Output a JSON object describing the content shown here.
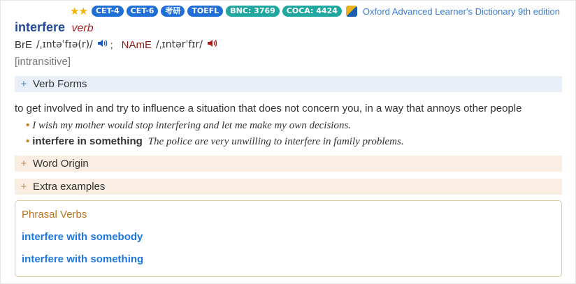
{
  "header": {
    "stars": "★★",
    "badges": [
      "CET-4",
      "CET-6",
      "考研",
      "TOEFL",
      "BNC: 3769",
      "COCA: 4424"
    ],
    "dictionary_name": "Oxford Advanced Learner's Dictionary 9th edition"
  },
  "entry": {
    "headword": "interfere",
    "pos": "verb",
    "pron_br_label": "BrE",
    "pron_br_ipa": "/ˌɪntəˈfɪə(r)/",
    "pron_separator": ";",
    "pron_name_label": "NAmE",
    "pron_name_ipa": "/ˌɪntərˈfɪr/",
    "grammar": "[intransitive]"
  },
  "sections": {
    "verb_forms": "Verb Forms",
    "word_origin": "Word Origin",
    "extra_examples": "Extra examples",
    "plus": "+"
  },
  "sense": {
    "definition": "to get involved in and try to influence a situation that does not concern you, in a way that annoys other people",
    "examples": [
      {
        "collocation": "",
        "text": "I wish my mother would stop interfering and let me make my own decisions."
      },
      {
        "collocation": "interfere in something",
        "text": "The police are very unwilling to interfere in family problems."
      }
    ]
  },
  "phrasal_verbs": {
    "title": "Phrasal Verbs",
    "items": [
      "interfere with somebody",
      "interfere with something"
    ]
  },
  "colors": {
    "badge_blue": "#1f6fd6",
    "badge_teal": "#1fa7a0",
    "headword": "#254b9c",
    "pos": "#9b1c1c",
    "link": "#1e78e0",
    "phrasal_border": "#e3c79e"
  },
  "icons": {
    "speaker_br": "speaker-blue-icon",
    "speaker_name": "speaker-red-icon",
    "dict_logo": "oxford-logo-icon"
  }
}
